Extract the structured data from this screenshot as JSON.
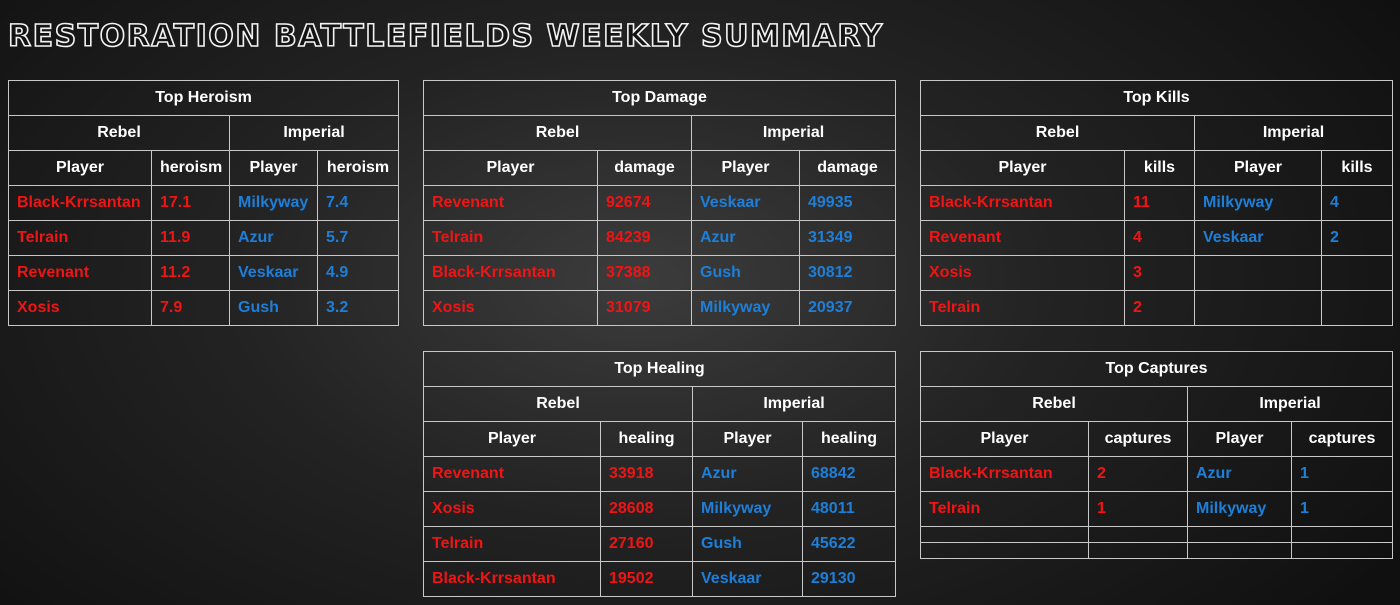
{
  "page": {
    "title": "RESTORATION BATTLEFIELDS WEEKLY SUMMARY"
  },
  "colors": {
    "rebel": "#f01414",
    "imperial": "#1e7fd8",
    "header_text": "#ffffff",
    "border": "#c8c8c8"
  },
  "tables": {
    "heroism": {
      "title": "Top Heroism",
      "rebel_label": "Rebel",
      "imperial_label": "Imperial",
      "player_col": "Player",
      "stat_col": "heroism",
      "rows": [
        {
          "rebel_player": "Black-Krrsantan",
          "rebel_value": "17.1",
          "imperial_player": "Milkyway",
          "imperial_value": "7.4"
        },
        {
          "rebel_player": "Telrain",
          "rebel_value": "11.9",
          "imperial_player": "Azur",
          "imperial_value": "5.7"
        },
        {
          "rebel_player": "Revenant",
          "rebel_value": "11.2",
          "imperial_player": "Veskaar",
          "imperial_value": "4.9"
        },
        {
          "rebel_player": "Xosis",
          "rebel_value": "7.9",
          "imperial_player": "Gush",
          "imperial_value": "3.2"
        }
      ]
    },
    "damage": {
      "title": "Top Damage",
      "rebel_label": "Rebel",
      "imperial_label": "Imperial",
      "player_col": "Player",
      "stat_col": "damage",
      "rows": [
        {
          "rebel_player": "Revenant",
          "rebel_value": "92674",
          "imperial_player": "Veskaar",
          "imperial_value": "49935"
        },
        {
          "rebel_player": "Telrain",
          "rebel_value": "84239",
          "imperial_player": "Azur",
          "imperial_value": "31349"
        },
        {
          "rebel_player": "Black-Krrsantan",
          "rebel_value": "37388",
          "imperial_player": "Gush",
          "imperial_value": "30812"
        },
        {
          "rebel_player": "Xosis",
          "rebel_value": "31079",
          "imperial_player": "Milkyway",
          "imperial_value": "20937"
        }
      ]
    },
    "kills": {
      "title": "Top Kills",
      "rebel_label": "Rebel",
      "imperial_label": "Imperial",
      "player_col": "Player",
      "stat_col": "kills",
      "rows": [
        {
          "rebel_player": "Black-Krrsantan",
          "rebel_value": "11",
          "imperial_player": "Milkyway",
          "imperial_value": "4"
        },
        {
          "rebel_player": "Revenant",
          "rebel_value": "4",
          "imperial_player": "Veskaar",
          "imperial_value": "2"
        },
        {
          "rebel_player": "Xosis",
          "rebel_value": "3",
          "imperial_player": "",
          "imperial_value": ""
        },
        {
          "rebel_player": "Telrain",
          "rebel_value": "2",
          "imperial_player": "",
          "imperial_value": ""
        }
      ]
    },
    "healing": {
      "title": "Top Healing",
      "rebel_label": "Rebel",
      "imperial_label": "Imperial",
      "player_col": "Player",
      "stat_col": "healing",
      "rows": [
        {
          "rebel_player": "Revenant",
          "rebel_value": "33918",
          "imperial_player": "Azur",
          "imperial_value": "68842"
        },
        {
          "rebel_player": "Xosis",
          "rebel_value": "28608",
          "imperial_player": "Milkyway",
          "imperial_value": "48011"
        },
        {
          "rebel_player": "Telrain",
          "rebel_value": "27160",
          "imperial_player": "Gush",
          "imperial_value": "45622"
        },
        {
          "rebel_player": "Black-Krrsantan",
          "rebel_value": "19502",
          "imperial_player": "Veskaar",
          "imperial_value": "29130"
        }
      ]
    },
    "captures": {
      "title": "Top Captures",
      "rebel_label": "Rebel",
      "imperial_label": "Imperial",
      "player_col": "Player",
      "stat_col": "captures",
      "rows": [
        {
          "rebel_player": "Black-Krrsantan",
          "rebel_value": "2",
          "imperial_player": "Azur",
          "imperial_value": "1"
        },
        {
          "rebel_player": "Telrain",
          "rebel_value": "1",
          "imperial_player": "Milkyway",
          "imperial_value": "1"
        },
        {
          "rebel_player": "",
          "rebel_value": "",
          "imperial_player": "",
          "imperial_value": ""
        },
        {
          "rebel_player": "",
          "rebel_value": "",
          "imperial_player": "",
          "imperial_value": ""
        }
      ]
    }
  }
}
